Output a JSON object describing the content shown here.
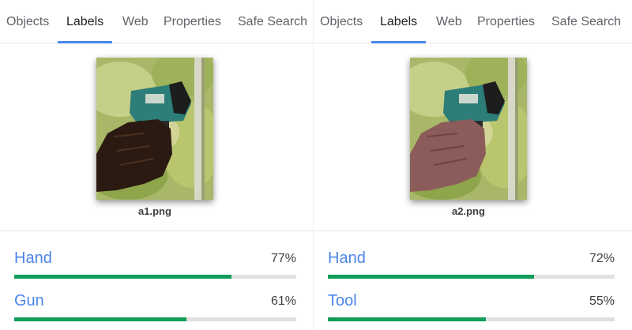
{
  "colors": {
    "accent": "#4a86e8",
    "bar_fill": "#0f9d58",
    "bar_track": "#e0e0e0"
  },
  "panels": [
    {
      "tabs": [
        {
          "label": "Objects",
          "active": false
        },
        {
          "label": "Labels",
          "active": true
        },
        {
          "label": "Web",
          "active": false
        },
        {
          "label": "Properties",
          "active": false
        },
        {
          "label": "Safe Search",
          "active": false
        }
      ],
      "image": {
        "filename": "a1.png",
        "hand_tone": "dark"
      },
      "labels": [
        {
          "name": "Hand",
          "score_text": "77%",
          "score": 0.77
        },
        {
          "name": "Gun",
          "score_text": "61%",
          "score": 0.61
        }
      ]
    },
    {
      "tabs": [
        {
          "label": "Objects",
          "active": false
        },
        {
          "label": "Labels",
          "active": true
        },
        {
          "label": "Web",
          "active": false
        },
        {
          "label": "Properties",
          "active": false
        },
        {
          "label": "Safe Search",
          "active": false
        }
      ],
      "image": {
        "filename": "a2.png",
        "hand_tone": "pink"
      },
      "labels": [
        {
          "name": "Hand",
          "score_text": "72%",
          "score": 0.72
        },
        {
          "name": "Tool",
          "score_text": "55%",
          "score": 0.55
        }
      ]
    }
  ]
}
